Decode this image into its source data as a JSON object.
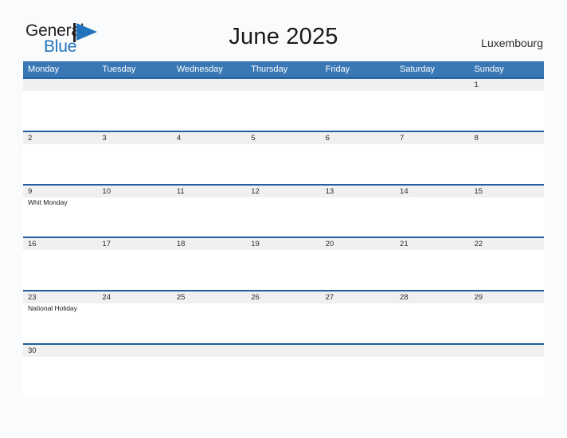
{
  "brand": {
    "name_part1": "General",
    "name_part2": "Blue",
    "flag_icon": "blue-flag-icon",
    "color_dark": "#231f20",
    "color_blue": "#1f74bd"
  },
  "header": {
    "title": "June 2025",
    "country": "Luxembourg"
  },
  "calendar": {
    "accent_color": "#3a78b5",
    "rule_color": "#1f5fa0",
    "band_color": "#f0f0f0",
    "weekdays": [
      "Monday",
      "Tuesday",
      "Wednesday",
      "Thursday",
      "Friday",
      "Saturday",
      "Sunday"
    ],
    "weeks": [
      {
        "days": [
          {
            "num": "",
            "event": ""
          },
          {
            "num": "",
            "event": ""
          },
          {
            "num": "",
            "event": ""
          },
          {
            "num": "",
            "event": ""
          },
          {
            "num": "",
            "event": ""
          },
          {
            "num": "",
            "event": ""
          },
          {
            "num": "1",
            "event": ""
          }
        ]
      },
      {
        "days": [
          {
            "num": "2",
            "event": ""
          },
          {
            "num": "3",
            "event": ""
          },
          {
            "num": "4",
            "event": ""
          },
          {
            "num": "5",
            "event": ""
          },
          {
            "num": "6",
            "event": ""
          },
          {
            "num": "7",
            "event": ""
          },
          {
            "num": "8",
            "event": ""
          }
        ]
      },
      {
        "days": [
          {
            "num": "9",
            "event": "Whit Monday"
          },
          {
            "num": "10",
            "event": ""
          },
          {
            "num": "11",
            "event": ""
          },
          {
            "num": "12",
            "event": ""
          },
          {
            "num": "13",
            "event": ""
          },
          {
            "num": "14",
            "event": ""
          },
          {
            "num": "15",
            "event": ""
          }
        ]
      },
      {
        "days": [
          {
            "num": "16",
            "event": ""
          },
          {
            "num": "17",
            "event": ""
          },
          {
            "num": "18",
            "event": ""
          },
          {
            "num": "19",
            "event": ""
          },
          {
            "num": "20",
            "event": ""
          },
          {
            "num": "21",
            "event": ""
          },
          {
            "num": "22",
            "event": ""
          }
        ]
      },
      {
        "days": [
          {
            "num": "23",
            "event": "National Holiday"
          },
          {
            "num": "24",
            "event": ""
          },
          {
            "num": "25",
            "event": ""
          },
          {
            "num": "26",
            "event": ""
          },
          {
            "num": "27",
            "event": ""
          },
          {
            "num": "28",
            "event": ""
          },
          {
            "num": "29",
            "event": ""
          }
        ]
      },
      {
        "days": [
          {
            "num": "30",
            "event": ""
          },
          {
            "num": "",
            "event": ""
          },
          {
            "num": "",
            "event": ""
          },
          {
            "num": "",
            "event": ""
          },
          {
            "num": "",
            "event": ""
          },
          {
            "num": "",
            "event": ""
          },
          {
            "num": "",
            "event": ""
          }
        ]
      }
    ]
  }
}
